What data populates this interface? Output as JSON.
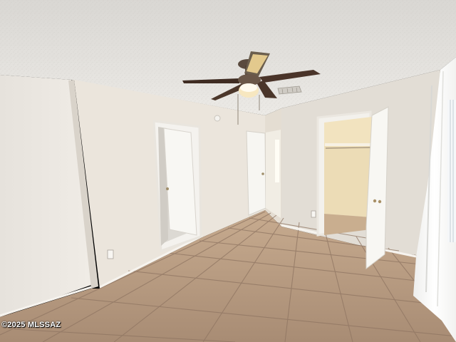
{
  "photo": {
    "watermark": "©2025 MLSSAZ",
    "subject": "empty-bedroom",
    "colors": {
      "ceiling": "#e4e2de",
      "wall_left": "#ece8e2",
      "wall_center": "#e8e2d9",
      "wall_back": "#e6e0d6",
      "wall_right": "#ddd8d0",
      "floor": "#b89d83",
      "grout": "#8f7562",
      "door": "#f7f6f2",
      "fan_blade": "#4a3429"
    }
  }
}
